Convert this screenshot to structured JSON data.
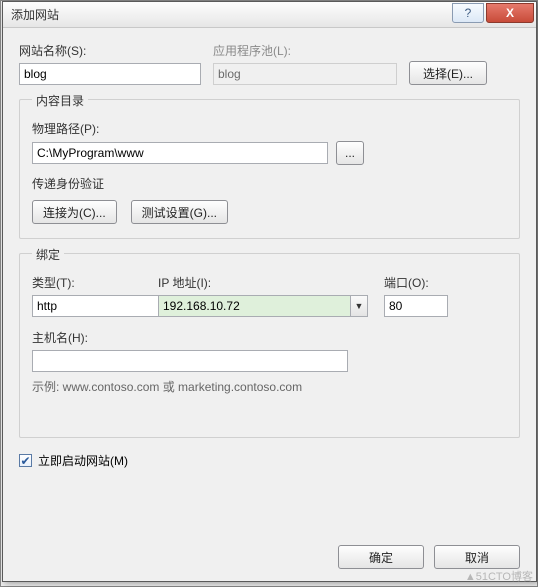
{
  "titlebar": {
    "title": "添加网站",
    "help_glyph": "?",
    "close_glyph": "X"
  },
  "siteName": {
    "label": "网站名称(S):",
    "value": "blog"
  },
  "appPool": {
    "label": "应用程序池(L):",
    "value": "blog",
    "select_label": "选择(E)..."
  },
  "content": {
    "legend": "内容目录",
    "path_label": "物理路径(P):",
    "path_value": "C:\\MyProgram\\www",
    "browse_label": "...",
    "auth_label": "传递身份验证",
    "connect_as_label": "连接为(C)...",
    "test_label": "测试设置(G)..."
  },
  "binding": {
    "legend": "绑定",
    "type_label": "类型(T):",
    "type_value": "http",
    "ip_label": "IP 地址(I):",
    "ip_value": "192.168.10.72",
    "port_label": "端口(O):",
    "port_value": "80",
    "host_label": "主机名(H):",
    "host_value": "",
    "hint": "示例: www.contoso.com 或 marketing.contoso.com"
  },
  "start": {
    "checked": true,
    "label": "立即启动网站(M)",
    "check_glyph": "✔"
  },
  "footer": {
    "ok": "确定",
    "cancel": "取消"
  },
  "watermark": "▲51CTO博客"
}
